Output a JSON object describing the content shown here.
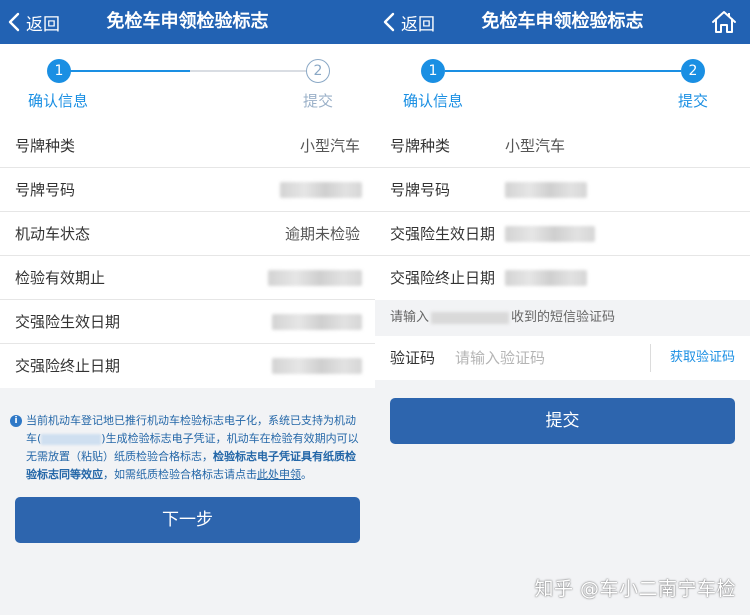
{
  "colors": {
    "nav_bg": "#2262b3",
    "accent": "#1a8fe3",
    "button_bg": "#2d65ae",
    "notice_text": "#2467a8"
  },
  "left": {
    "nav": {
      "back_label": "返回",
      "title": "免检车申领检验标志"
    },
    "steps": [
      {
        "number": "1",
        "label": "确认信息",
        "active": true
      },
      {
        "number": "2",
        "label": "提交",
        "active": false
      }
    ],
    "rows": [
      {
        "label": "号牌种类",
        "value": "小型汽车"
      },
      {
        "label": "号牌号码",
        "value": ""
      },
      {
        "label": "机动车状态",
        "value": "逾期未检验"
      },
      {
        "label": "检验有效期止",
        "value": ""
      },
      {
        "label": "交强险生效日期",
        "value": ""
      },
      {
        "label": "交强险终止日期",
        "value": ""
      }
    ],
    "notice": {
      "icon": "info-icon",
      "part1": "当前机动车登记地已推行机动车检验标志电子化，系统已支持为机动车(",
      "part2": ")生成检验标志电子凭证，机动车在检验有效期内可以无需放置（粘贴）纸质检验合格标志，",
      "bold": "检验标志电子凭证具有纸质检验标志同等效应",
      "part3": "，如需纸质检验合格标志请点击",
      "link": "此处申领",
      "end": "。"
    },
    "next_button": "下一步"
  },
  "right": {
    "nav": {
      "back_label": "返回",
      "title": "免检车申领检验标志",
      "home_icon": "home-icon"
    },
    "steps": [
      {
        "number": "1",
        "label": "确认信息",
        "active": true
      },
      {
        "number": "2",
        "label": "提交",
        "active": true
      }
    ],
    "rows": [
      {
        "label": "号牌种类",
        "value": "小型汽车"
      },
      {
        "label": "号牌号码",
        "value": ""
      },
      {
        "label": "交强险生效日期",
        "value": ""
      },
      {
        "label": "交强险终止日期",
        "value": ""
      }
    ],
    "sms_hint_before": "请输入",
    "sms_hint_after": "收到的短信验证码",
    "code": {
      "label": "验证码",
      "placeholder": "请输入验证码",
      "value": "",
      "get_code": "获取验证码"
    },
    "submit_button": "提交"
  },
  "watermark": "知乎 @车小二南宁车检"
}
